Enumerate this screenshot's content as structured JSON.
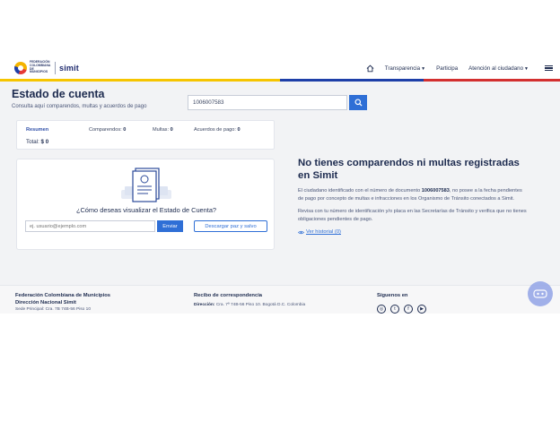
{
  "header": {
    "logo_text": "FEDERACIÓN COLOMBIANA DE MUNICIPIOS",
    "brand": "simit",
    "nav": [
      {
        "label": "Transparencia",
        "dropdown": true
      },
      {
        "label": "Participa",
        "dropdown": false
      },
      {
        "label": "Atención al ciudadano",
        "dropdown": true
      }
    ]
  },
  "page": {
    "title": "Estado de cuenta",
    "subtitle": "Consulta aquí comparendos, multas y acuerdos de pago"
  },
  "search": {
    "value": "1006007583"
  },
  "summary": {
    "label": "Resumen",
    "comparendos_label": "Comparendos:",
    "comparendos_value": "0",
    "multas_label": "Multas:",
    "multas_value": "0",
    "acuerdos_label": "Acuerdos de pago:",
    "acuerdos_value": "0",
    "total_label": "Total:",
    "total_value": "$ 0"
  },
  "card": {
    "question": "¿Cómo deseas visualizar el Estado de Cuenta?",
    "email_placeholder": "ej. usuario@ejemplo.com",
    "send_label": "Enviar",
    "download_label": "Descargar paz y salvo"
  },
  "result": {
    "title": "No tienes comparendos ni multas registradas en Simit",
    "para1_pre": "El ciudadano identificado con el número de documento ",
    "para1_doc": "1006007583",
    "para1_post": ", no posee a la fecha pendientes de pago por concepto de multas e infracciones en los Organismo de Tránsito conectados a Simit.",
    "para2": "Revisa con tu número de identificación y/o placa en las Secretarías de Tránsito y verifica que no tienes obligaciones pendientes de pago.",
    "history_label": "Ver historial (0)"
  },
  "footer": {
    "col1_h1": "Federación Colombiana de Municipios",
    "col1_h2": "Dirección Nacional Simit",
    "col1_cut": "Sede Principal: Cra. 7B 74B-56 Piso 10",
    "col2_h": "Recibo de correspondencia",
    "col2_label": "Dirección:",
    "col2_text": "Cra. 7ª 74B-56 Piso 10. Bogotá D.C. Colombia",
    "col3_h": "Síguenos en",
    "socials": [
      "instagram-icon",
      "twitter-icon",
      "facebook-icon",
      "youtube-icon"
    ]
  },
  "colors": {
    "primary": "#2f6fd6",
    "navy": "#1d2b4f",
    "flag_yellow": "#f6c500",
    "flag_blue": "#1e3fa8",
    "flag_red": "#d32f2f"
  }
}
